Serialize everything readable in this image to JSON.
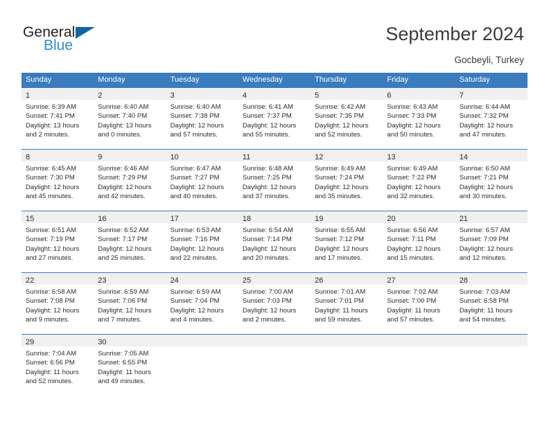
{
  "brand": {
    "name_part1": "General",
    "name_part2": "Blue",
    "triangle_icon": "triangle-icon",
    "color_dark": "#231f20",
    "color_blue": "#2e8ad4"
  },
  "header": {
    "title": "September 2024",
    "location": "Gocbeyli, Turkey"
  },
  "theme": {
    "header_row_bg": "#3a7cbe",
    "daynum_strip_bg": "#f0f0f0",
    "text": "#2b2b2b"
  },
  "calendar": {
    "weekday_headers": [
      "Sunday",
      "Monday",
      "Tuesday",
      "Wednesday",
      "Thursday",
      "Friday",
      "Saturday"
    ],
    "weeks": [
      [
        {
          "day": "1",
          "sunrise": "Sunrise: 6:39 AM",
          "sunset": "Sunset: 7:41 PM",
          "daylight_line1": "Daylight: 13 hours",
          "daylight_line2": "and 2 minutes."
        },
        {
          "day": "2",
          "sunrise": "Sunrise: 6:40 AM",
          "sunset": "Sunset: 7:40 PM",
          "daylight_line1": "Daylight: 13 hours",
          "daylight_line2": "and 0 minutes."
        },
        {
          "day": "3",
          "sunrise": "Sunrise: 6:40 AM",
          "sunset": "Sunset: 7:38 PM",
          "daylight_line1": "Daylight: 12 hours",
          "daylight_line2": "and 57 minutes."
        },
        {
          "day": "4",
          "sunrise": "Sunrise: 6:41 AM",
          "sunset": "Sunset: 7:37 PM",
          "daylight_line1": "Daylight: 12 hours",
          "daylight_line2": "and 55 minutes."
        },
        {
          "day": "5",
          "sunrise": "Sunrise: 6:42 AM",
          "sunset": "Sunset: 7:35 PM",
          "daylight_line1": "Daylight: 12 hours",
          "daylight_line2": "and 52 minutes."
        },
        {
          "day": "6",
          "sunrise": "Sunrise: 6:43 AM",
          "sunset": "Sunset: 7:33 PM",
          "daylight_line1": "Daylight: 12 hours",
          "daylight_line2": "and 50 minutes."
        },
        {
          "day": "7",
          "sunrise": "Sunrise: 6:44 AM",
          "sunset": "Sunset: 7:32 PM",
          "daylight_line1": "Daylight: 12 hours",
          "daylight_line2": "and 47 minutes."
        }
      ],
      [
        {
          "day": "8",
          "sunrise": "Sunrise: 6:45 AM",
          "sunset": "Sunset: 7:30 PM",
          "daylight_line1": "Daylight: 12 hours",
          "daylight_line2": "and 45 minutes."
        },
        {
          "day": "9",
          "sunrise": "Sunrise: 6:46 AM",
          "sunset": "Sunset: 7:29 PM",
          "daylight_line1": "Daylight: 12 hours",
          "daylight_line2": "and 42 minutes."
        },
        {
          "day": "10",
          "sunrise": "Sunrise: 6:47 AM",
          "sunset": "Sunset: 7:27 PM",
          "daylight_line1": "Daylight: 12 hours",
          "daylight_line2": "and 40 minutes."
        },
        {
          "day": "11",
          "sunrise": "Sunrise: 6:48 AM",
          "sunset": "Sunset: 7:25 PM",
          "daylight_line1": "Daylight: 12 hours",
          "daylight_line2": "and 37 minutes."
        },
        {
          "day": "12",
          "sunrise": "Sunrise: 6:49 AM",
          "sunset": "Sunset: 7:24 PM",
          "daylight_line1": "Daylight: 12 hours",
          "daylight_line2": "and 35 minutes."
        },
        {
          "day": "13",
          "sunrise": "Sunrise: 6:49 AM",
          "sunset": "Sunset: 7:22 PM",
          "daylight_line1": "Daylight: 12 hours",
          "daylight_line2": "and 32 minutes."
        },
        {
          "day": "14",
          "sunrise": "Sunrise: 6:50 AM",
          "sunset": "Sunset: 7:21 PM",
          "daylight_line1": "Daylight: 12 hours",
          "daylight_line2": "and 30 minutes."
        }
      ],
      [
        {
          "day": "15",
          "sunrise": "Sunrise: 6:51 AM",
          "sunset": "Sunset: 7:19 PM",
          "daylight_line1": "Daylight: 12 hours",
          "daylight_line2": "and 27 minutes."
        },
        {
          "day": "16",
          "sunrise": "Sunrise: 6:52 AM",
          "sunset": "Sunset: 7:17 PM",
          "daylight_line1": "Daylight: 12 hours",
          "daylight_line2": "and 25 minutes."
        },
        {
          "day": "17",
          "sunrise": "Sunrise: 6:53 AM",
          "sunset": "Sunset: 7:16 PM",
          "daylight_line1": "Daylight: 12 hours",
          "daylight_line2": "and 22 minutes."
        },
        {
          "day": "18",
          "sunrise": "Sunrise: 6:54 AM",
          "sunset": "Sunset: 7:14 PM",
          "daylight_line1": "Daylight: 12 hours",
          "daylight_line2": "and 20 minutes."
        },
        {
          "day": "19",
          "sunrise": "Sunrise: 6:55 AM",
          "sunset": "Sunset: 7:12 PM",
          "daylight_line1": "Daylight: 12 hours",
          "daylight_line2": "and 17 minutes."
        },
        {
          "day": "20",
          "sunrise": "Sunrise: 6:56 AM",
          "sunset": "Sunset: 7:11 PM",
          "daylight_line1": "Daylight: 12 hours",
          "daylight_line2": "and 15 minutes."
        },
        {
          "day": "21",
          "sunrise": "Sunrise: 6:57 AM",
          "sunset": "Sunset: 7:09 PM",
          "daylight_line1": "Daylight: 12 hours",
          "daylight_line2": "and 12 minutes."
        }
      ],
      [
        {
          "day": "22",
          "sunrise": "Sunrise: 6:58 AM",
          "sunset": "Sunset: 7:08 PM",
          "daylight_line1": "Daylight: 12 hours",
          "daylight_line2": "and 9 minutes."
        },
        {
          "day": "23",
          "sunrise": "Sunrise: 6:59 AM",
          "sunset": "Sunset: 7:06 PM",
          "daylight_line1": "Daylight: 12 hours",
          "daylight_line2": "and 7 minutes."
        },
        {
          "day": "24",
          "sunrise": "Sunrise: 6:59 AM",
          "sunset": "Sunset: 7:04 PM",
          "daylight_line1": "Daylight: 12 hours",
          "daylight_line2": "and 4 minutes."
        },
        {
          "day": "25",
          "sunrise": "Sunrise: 7:00 AM",
          "sunset": "Sunset: 7:03 PM",
          "daylight_line1": "Daylight: 12 hours",
          "daylight_line2": "and 2 minutes."
        },
        {
          "day": "26",
          "sunrise": "Sunrise: 7:01 AM",
          "sunset": "Sunset: 7:01 PM",
          "daylight_line1": "Daylight: 11 hours",
          "daylight_line2": "and 59 minutes."
        },
        {
          "day": "27",
          "sunrise": "Sunrise: 7:02 AM",
          "sunset": "Sunset: 7:00 PM",
          "daylight_line1": "Daylight: 11 hours",
          "daylight_line2": "and 57 minutes."
        },
        {
          "day": "28",
          "sunrise": "Sunrise: 7:03 AM",
          "sunset": "Sunset: 6:58 PM",
          "daylight_line1": "Daylight: 11 hours",
          "daylight_line2": "and 54 minutes."
        }
      ],
      [
        {
          "day": "29",
          "sunrise": "Sunrise: 7:04 AM",
          "sunset": "Sunset: 6:56 PM",
          "daylight_line1": "Daylight: 11 hours",
          "daylight_line2": "and 52 minutes."
        },
        {
          "day": "30",
          "sunrise": "Sunrise: 7:05 AM",
          "sunset": "Sunset: 6:55 PM",
          "daylight_line1": "Daylight: 11 hours",
          "daylight_line2": "and 49 minutes."
        },
        {
          "day": "",
          "sunrise": "",
          "sunset": "",
          "daylight_line1": "",
          "daylight_line2": ""
        },
        {
          "day": "",
          "sunrise": "",
          "sunset": "",
          "daylight_line1": "",
          "daylight_line2": ""
        },
        {
          "day": "",
          "sunrise": "",
          "sunset": "",
          "daylight_line1": "",
          "daylight_line2": ""
        },
        {
          "day": "",
          "sunrise": "",
          "sunset": "",
          "daylight_line1": "",
          "daylight_line2": ""
        },
        {
          "day": "",
          "sunrise": "",
          "sunset": "",
          "daylight_line1": "",
          "daylight_line2": ""
        }
      ]
    ]
  }
}
